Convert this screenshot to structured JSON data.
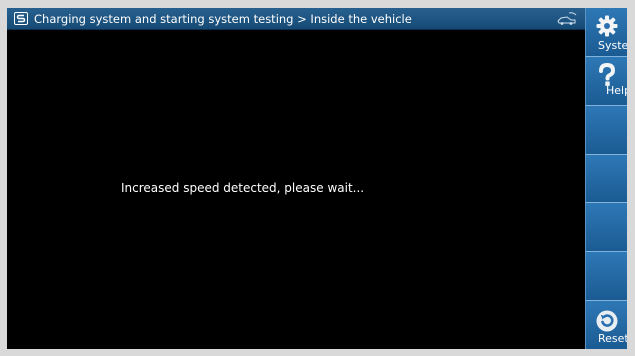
{
  "titlebar": {
    "title": "Charging system and starting system testing > Inside the vehicle"
  },
  "main": {
    "message": "Increased speed detected, please wait..."
  },
  "sidebar": {
    "buttons": [
      {
        "label": "System",
        "icon": "gear-icon"
      },
      {
        "label": "Help",
        "icon": "question-icon"
      },
      {
        "label": "",
        "icon": ""
      },
      {
        "label": "",
        "icon": ""
      },
      {
        "label": "",
        "icon": ""
      },
      {
        "label": "",
        "icon": ""
      },
      {
        "label": "Reset",
        "icon": "reset-icon"
      }
    ]
  },
  "colors": {
    "titlebar": "#1f5a8a",
    "sidebar": "#2467a3",
    "screen_background": "#000000",
    "text": "#ffffff"
  }
}
